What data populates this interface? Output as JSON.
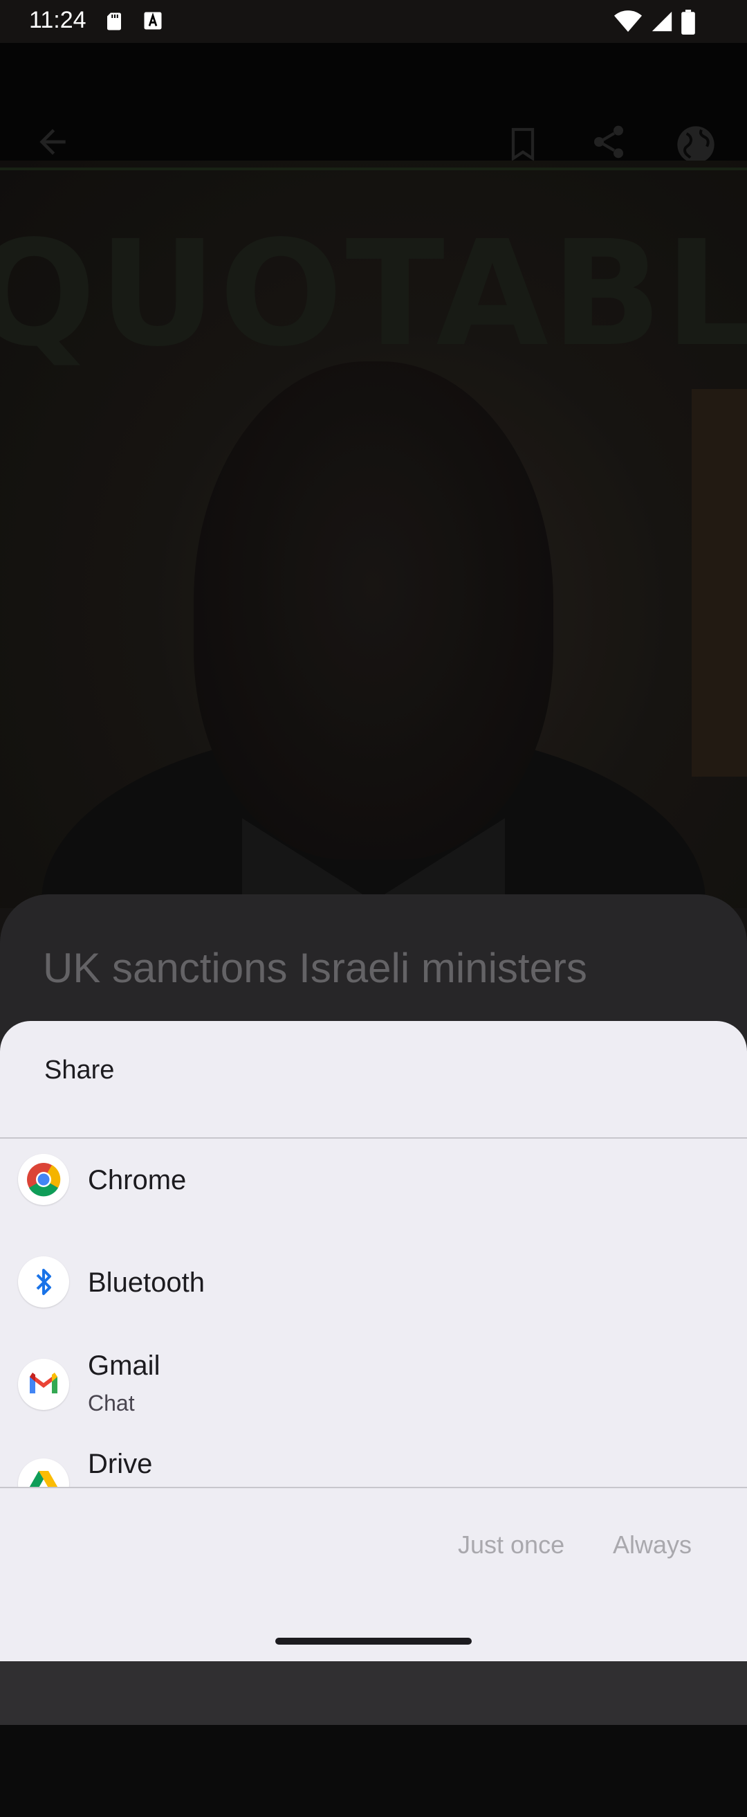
{
  "status_bar": {
    "time": "11:24",
    "icons": [
      "sd-card-icon",
      "a-box-icon",
      "wifi-icon",
      "cell-signal-icon",
      "battery-icon"
    ]
  },
  "background_app": {
    "toolbar_icons": [
      "back-arrow-icon",
      "bookmark-icon",
      "share-icon",
      "globe-icon"
    ],
    "hero_text": "QUOTABLE",
    "headline": "UK sanctions Israeli ministers"
  },
  "share_sheet": {
    "title": "Share",
    "apps": [
      {
        "label": "Chrome",
        "sublabel": "",
        "icon": "chrome-icon"
      },
      {
        "label": "Bluetooth",
        "sublabel": "",
        "icon": "bluetooth-icon"
      },
      {
        "label": "Gmail",
        "sublabel": "Chat",
        "icon": "gmail-icon"
      },
      {
        "label": "Drive",
        "sublabel": "",
        "icon": "drive-icon"
      }
    ],
    "just_once_label": "Just once",
    "always_label": "Always"
  },
  "colors": {
    "sheet_bg": "#eeedf3",
    "disabled_text": "#a9a8ad"
  }
}
